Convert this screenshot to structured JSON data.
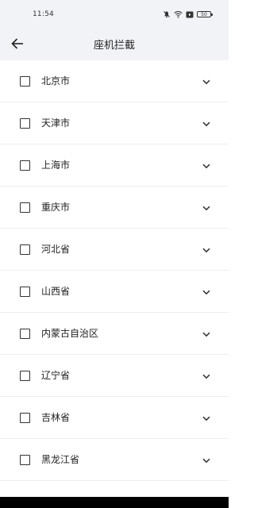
{
  "status_bar": {
    "time": "11:54",
    "battery": "50"
  },
  "app_bar": {
    "back_icon": "arrow-left-icon",
    "title": "座机拦截"
  },
  "regions": [
    {
      "label": "北京市"
    },
    {
      "label": "天津市"
    },
    {
      "label": "上海市"
    },
    {
      "label": "重庆市"
    },
    {
      "label": "河北省"
    },
    {
      "label": "山西省"
    },
    {
      "label": "内蒙古自治区"
    },
    {
      "label": "辽宁省"
    },
    {
      "label": "吉林省"
    },
    {
      "label": "黑龙江省"
    }
  ]
}
